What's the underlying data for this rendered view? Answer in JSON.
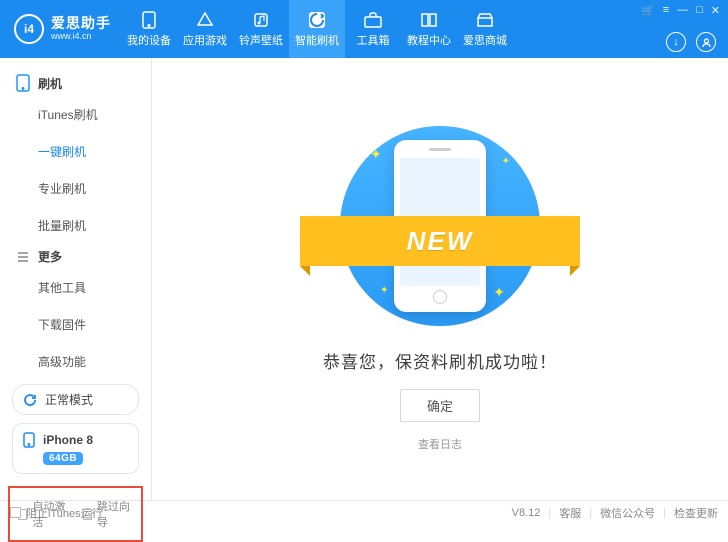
{
  "brand": {
    "logo_text": "i4",
    "name": "爱思助手",
    "url": "www.i4.cn"
  },
  "nav": [
    {
      "label": "我的设备",
      "icon": "phone"
    },
    {
      "label": "应用游戏",
      "icon": "apps"
    },
    {
      "label": "铃声壁纸",
      "icon": "music"
    },
    {
      "label": "智能刷机",
      "icon": "flash",
      "active": true
    },
    {
      "label": "工具箱",
      "icon": "toolbox"
    },
    {
      "label": "教程中心",
      "icon": "book"
    },
    {
      "label": "爱思商城",
      "icon": "store"
    }
  ],
  "window_controls": {
    "cart": "🛒",
    "menu": "≡",
    "min": "—",
    "max": "□",
    "close": "✕"
  },
  "sidebar": {
    "sections": [
      {
        "title": "刷机",
        "items": [
          "iTunes刷机",
          "一键刷机",
          "专业刷机",
          "批量刷机"
        ],
        "active_index": 1
      },
      {
        "title": "更多",
        "items": [
          "其他工具",
          "下载固件",
          "高级功能"
        ]
      }
    ],
    "mode": {
      "label": "正常模式",
      "icon": "refresh"
    },
    "device": {
      "name": "iPhone 8",
      "badge": "64GB",
      "icon": "phone"
    },
    "bottom_options": [
      "自动激活",
      "跳过向导"
    ]
  },
  "main": {
    "ribbon": "NEW",
    "message": "恭喜您，保资料刷机成功啦！",
    "ok_button": "确定",
    "log_link": "查看日志"
  },
  "status": {
    "prevent_itunes": "阻止iTunes运行",
    "version": "V8.12",
    "support": "客服",
    "wechat": "微信公众号",
    "update": "检查更新"
  }
}
